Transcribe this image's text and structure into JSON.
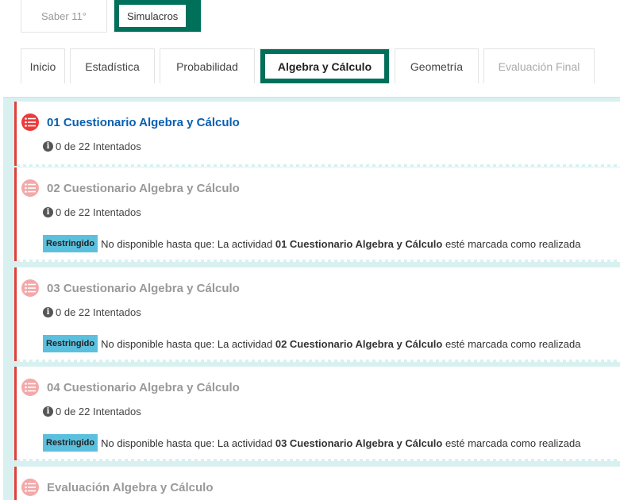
{
  "top_tabs": [
    {
      "label": "Saber 11°",
      "active": false
    },
    {
      "label": "Simulacros",
      "active": true
    }
  ],
  "section_tabs": [
    {
      "label": "Inicio",
      "active": false,
      "disabled": false
    },
    {
      "label": "Estadística",
      "active": false,
      "disabled": false
    },
    {
      "label": "Probabilidad",
      "active": false,
      "disabled": false
    },
    {
      "label": "Algebra y Cálculo",
      "active": true,
      "disabled": false
    },
    {
      "label": "Geometría",
      "active": false,
      "disabled": false
    },
    {
      "label": "Evaluación Final",
      "active": false,
      "disabled": true
    }
  ],
  "activities": [
    {
      "title": "01 Cuestionario Algebra y Cálculo",
      "available": true,
      "attempts": "0 de 22 Intentados",
      "restriction": null
    },
    {
      "title": "02 Cuestionario Algebra y Cálculo",
      "available": false,
      "attempts": "0 de 22 Intentados",
      "restriction": {
        "badge": "Restringido",
        "prefix": "No disponible hasta que: La actividad",
        "activity": "01 Cuestionario Algebra y Cálculo",
        "suffix": "esté marcada como realizada"
      }
    },
    {
      "title": "03 Cuestionario Algebra y Cálculo",
      "available": false,
      "attempts": "0 de 22 Intentados",
      "restriction": {
        "badge": "Restringido",
        "prefix": "No disponible hasta que: La actividad",
        "activity": "02 Cuestionario Algebra y Cálculo",
        "suffix": "esté marcada como realizada"
      }
    },
    {
      "title": "04 Cuestionario Algebra y Cálculo",
      "available": false,
      "attempts": "0 de 22 Intentados",
      "restriction": {
        "badge": "Restringido",
        "prefix": "No disponible hasta que: La actividad",
        "activity": "03 Cuestionario Algebra y Cálculo",
        "suffix": "esté marcada como realizada"
      }
    },
    {
      "title": "Evaluación Algebra y Cálculo",
      "available": false,
      "attempts": null,
      "restriction": null
    }
  ],
  "colors": {
    "accent": "#00705a",
    "link": "#0b5fb0",
    "badge": "#5bc0de",
    "status_red": "#e0403a"
  },
  "icons": {
    "activity": "quiz-list-icon",
    "info": "info-circle-icon"
  }
}
